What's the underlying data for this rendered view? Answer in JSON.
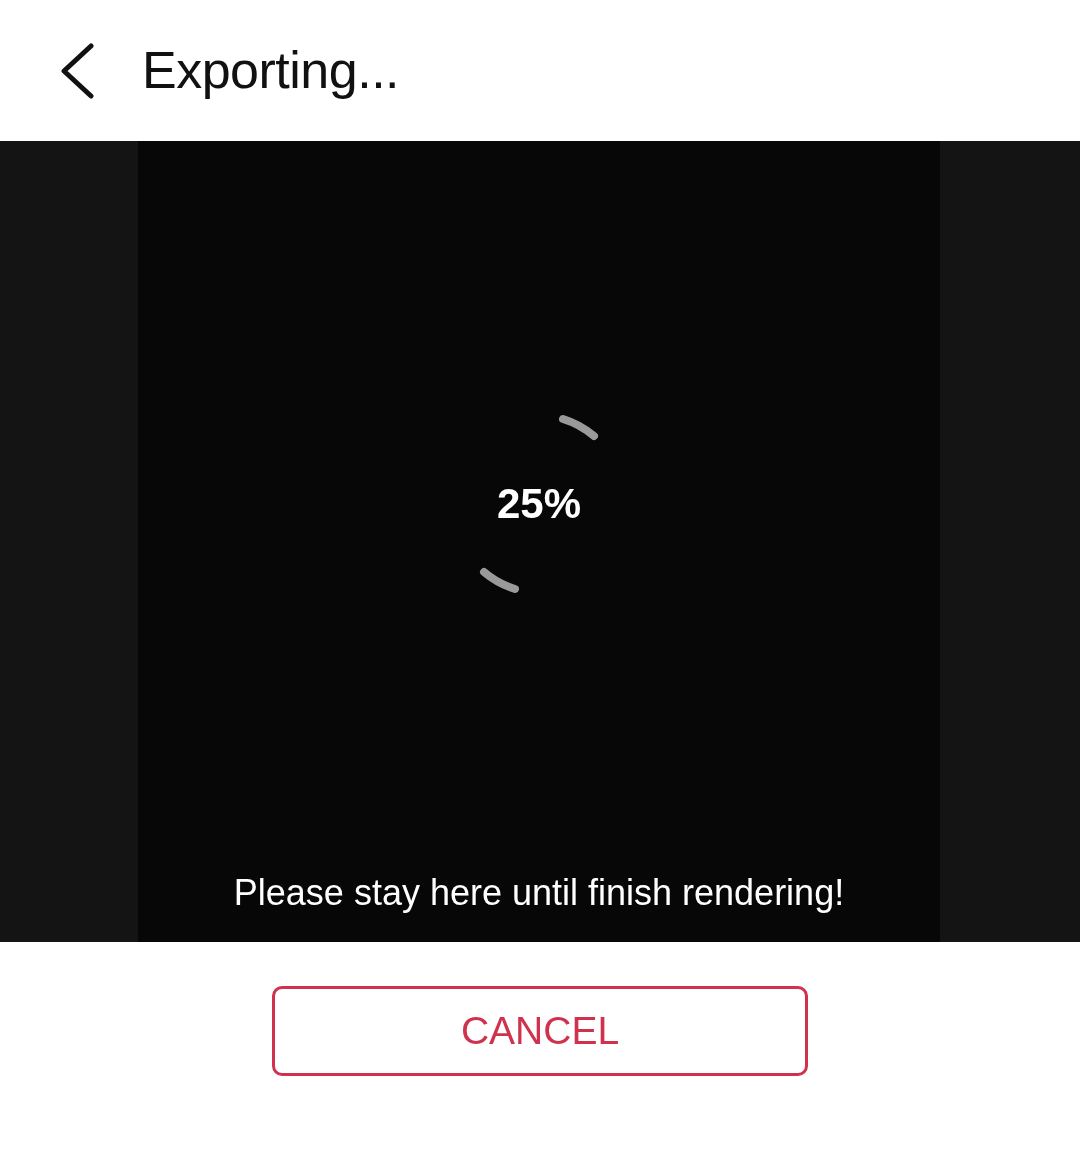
{
  "header": {
    "title": "Exporting..."
  },
  "progress": {
    "reading": "25%"
  },
  "message": "Please stay here until finish rendering!",
  "buttons": [
    {
      "label": "CANCEL"
    }
  ]
}
